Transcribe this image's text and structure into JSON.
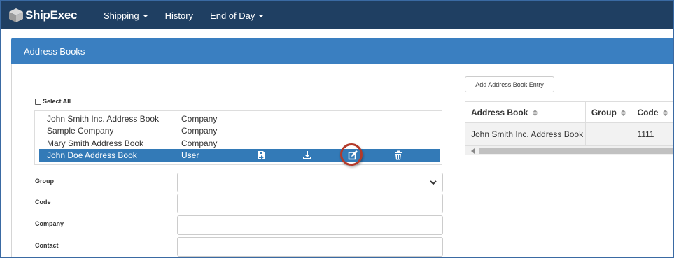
{
  "nav": {
    "brand": "ShipExec",
    "items": [
      {
        "label": "Shipping",
        "has_caret": true
      },
      {
        "label": "History",
        "has_caret": false
      },
      {
        "label": "End of Day",
        "has_caret": true
      }
    ]
  },
  "panel": {
    "title": "Address Books"
  },
  "address_books": {
    "select_all_label": "Select All",
    "rows": [
      {
        "name": "John Smith Inc. Address Book",
        "type": "Company"
      },
      {
        "name": "Sample Company",
        "type": "Company"
      },
      {
        "name": "Mary Smith Address Book",
        "type": "Company"
      },
      {
        "name": "John Doe Address Book",
        "type": "User",
        "selected": true
      }
    ],
    "row_actions": [
      "import-icon",
      "download-icon",
      "edit-icon",
      "trash-icon"
    ]
  },
  "form": {
    "group_label": "Group",
    "group_value": "",
    "code_label": "Code",
    "code_value": "",
    "company_label": "Company",
    "company_value": "",
    "contact_label": "Contact",
    "contact_value": ""
  },
  "entries": {
    "add_button_label": "Add Address Book Entry",
    "columns": [
      "Address Book",
      "Group",
      "Code"
    ],
    "rows": [
      {
        "address_book": "John Smith Inc. Address Book",
        "group": "",
        "code": "1111"
      }
    ]
  },
  "colors": {
    "navbar": "#1f3f62",
    "panel_heading": "#3a7fc1",
    "selected_row": "#337ab7",
    "highlight_ring": "#b33a2a"
  }
}
